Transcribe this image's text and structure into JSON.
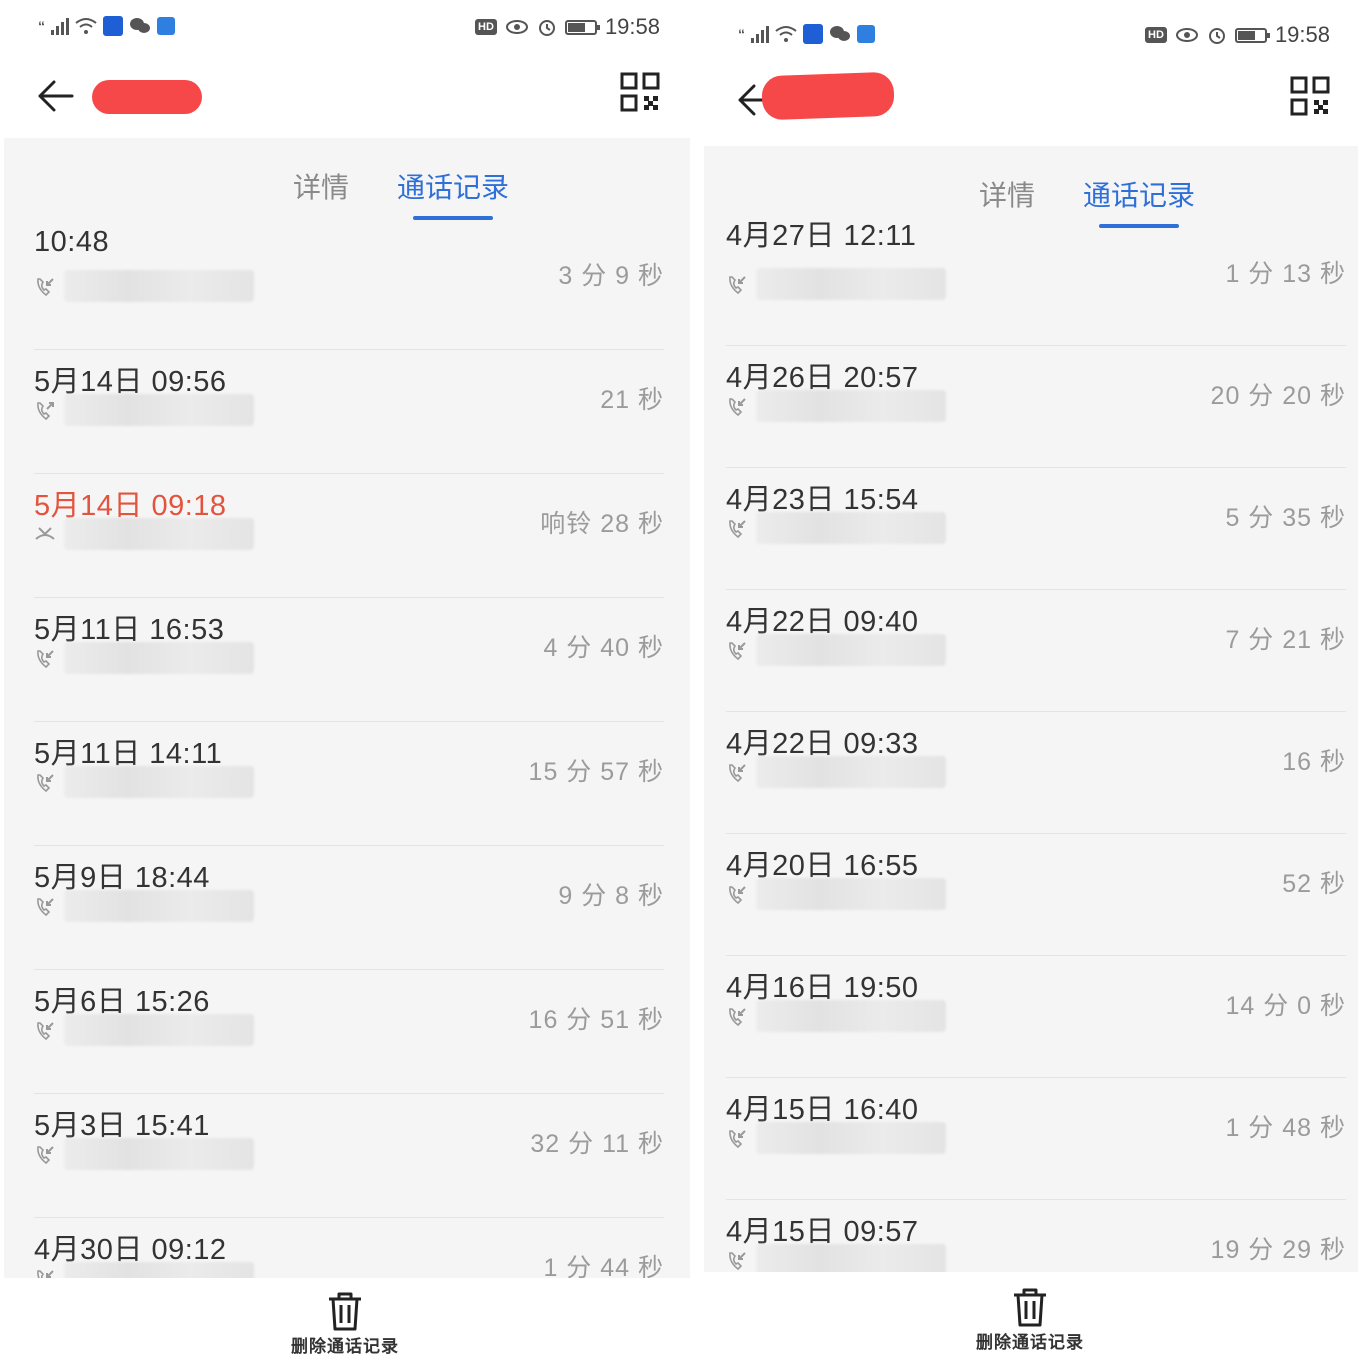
{
  "status_bar": {
    "carrier_mark": "“",
    "time": "19:58",
    "hd_badge": "HD",
    "app_icon_colors": [
      "#1f5fd6",
      "#555555",
      "#2f7fe0"
    ]
  },
  "tabs": {
    "details": "详情",
    "call_log": "通话记录"
  },
  "footer": {
    "delete_label": "删除通话记录"
  },
  "accent_color": "#2f6fd8",
  "missed_color": "#e4533d",
  "left_panel": {
    "calls": [
      {
        "when": "10:48",
        "duration": "3 分 9 秒",
        "type": "incoming"
      },
      {
        "when": "5月14日 09:56",
        "duration": "21 秒",
        "type": "outgoing"
      },
      {
        "when": "5月14日 09:18",
        "duration": "响铃 28 秒",
        "type": "missed"
      },
      {
        "when": "5月11日 16:53",
        "duration": "4 分 40 秒",
        "type": "incoming"
      },
      {
        "when": "5月11日 14:11",
        "duration": "15 分 57 秒",
        "type": "incoming"
      },
      {
        "when": "5月9日 18:44",
        "duration": "9 分 8 秒",
        "type": "incoming"
      },
      {
        "when": "5月6日 15:26",
        "duration": "16 分 51 秒",
        "type": "incoming"
      },
      {
        "when": "5月3日 15:41",
        "duration": "32 分 11 秒",
        "type": "incoming"
      },
      {
        "when": "4月30日 09:12",
        "duration": "1 分 44 秒",
        "type": "incoming"
      }
    ]
  },
  "right_panel": {
    "calls": [
      {
        "when": "4月27日 12:11",
        "duration": "1 分 13 秒",
        "type": "incoming"
      },
      {
        "when": "4月26日 20:57",
        "duration": "20 分 20 秒",
        "type": "incoming"
      },
      {
        "when": "4月23日 15:54",
        "duration": "5 分 35 秒",
        "type": "incoming"
      },
      {
        "when": "4月22日 09:40",
        "duration": "7 分 21 秒",
        "type": "incoming"
      },
      {
        "when": "4月22日 09:33",
        "duration": "16 秒",
        "type": "incoming"
      },
      {
        "when": "4月20日 16:55",
        "duration": "52 秒",
        "type": "incoming"
      },
      {
        "when": "4月16日 19:50",
        "duration": "14 分 0 秒",
        "type": "incoming"
      },
      {
        "when": "4月15日 16:40",
        "duration": "1 分 48 秒",
        "type": "incoming"
      },
      {
        "when": "4月15日 09:57",
        "duration": "19 分 29 秒",
        "type": "incoming"
      }
    ]
  }
}
